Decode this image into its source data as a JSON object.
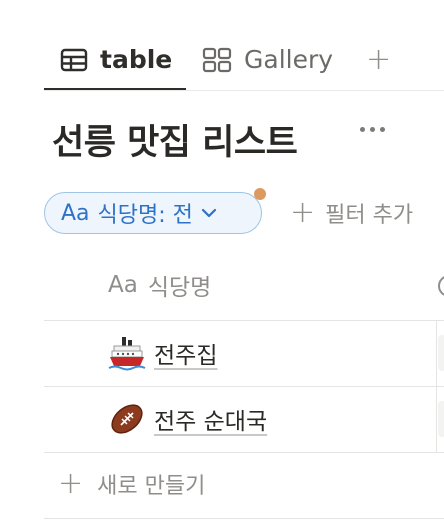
{
  "tabs": [
    {
      "label": "table",
      "icon": "table-icon",
      "active": true
    },
    {
      "label": "Gallery",
      "icon": "gallery-icon",
      "active": false
    }
  ],
  "add_view_symbol": "+",
  "page_title": "선릉 맛집 리스트",
  "filter_chip": {
    "prefix": "Aa",
    "label": "식당명: 전",
    "accent_color": "#2e72c7",
    "indicator_color": "#dd9a5f"
  },
  "add_filter": {
    "symbol": "+",
    "label": "필터 추가"
  },
  "column": {
    "prefix": "Aa",
    "label": "식당명"
  },
  "rows": [
    {
      "icon": "ship-emoji-icon",
      "name": "전주집"
    },
    {
      "icon": "football-emoji-icon",
      "name": "전주 순대국"
    }
  ],
  "new_row": {
    "symbol": "+",
    "label": "새로 만들기"
  }
}
